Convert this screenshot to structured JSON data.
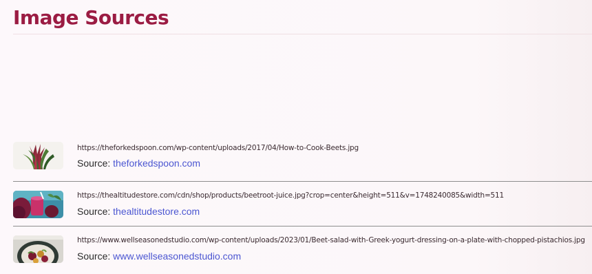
{
  "page": {
    "title": "Image Sources"
  },
  "sources": [
    {
      "url": "https://theforkedspoon.com/wp-content/uploads/2017/04/How-to-Cook-Beets.jpg",
      "source_label": "Source:",
      "domain": "theforkedspoon.com"
    },
    {
      "url": "https://thealtitudestore.com/cdn/shop/products/beetroot-juice.jpg?crop=center&height=511&v=1748240085&width=511",
      "source_label": "Source:",
      "domain": "thealtitudestore.com"
    },
    {
      "url": "https://www.wellseasonedstudio.com/wp-content/uploads/2023/01/Beet-salad-with-Greek-yogurt-dressing-on-a-plate-with-chopped-pistachios.jpg",
      "source_label": "Source:",
      "domain": "www.wellseasonedstudio.com"
    }
  ]
}
